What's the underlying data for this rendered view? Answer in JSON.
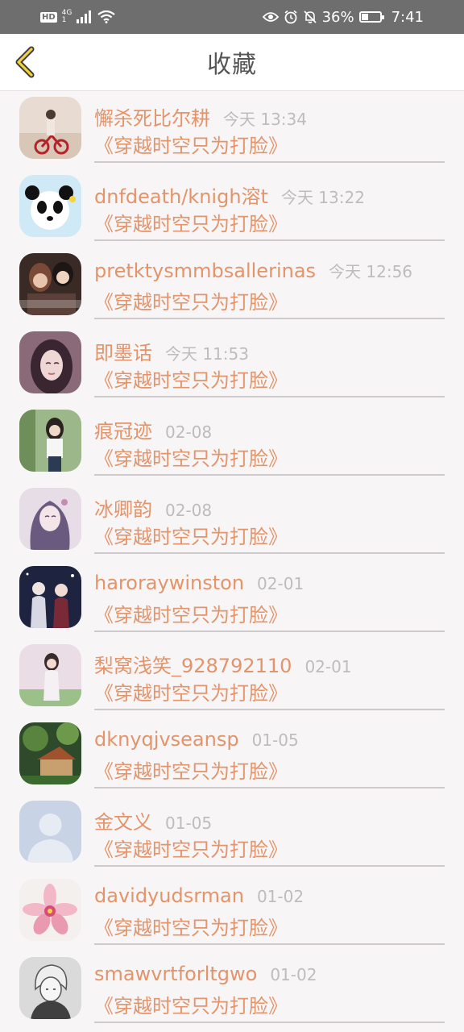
{
  "status_bar": {
    "hd": "HD",
    "network_top": "4G",
    "network_bottom": "1",
    "battery_pct": "36%",
    "battery_level": 0.36,
    "time": "7:41"
  },
  "header": {
    "title": "收藏",
    "back_icon": "chevron-left-icon"
  },
  "colors": {
    "accent": "#e3946a",
    "time": "#bdbdbd",
    "title": "#555555"
  },
  "favorites": [
    {
      "name": "懈杀死比尔耕",
      "time": "今天 13:34",
      "book": "《穿越时空只为打脸》"
    },
    {
      "name": "dnfdeath/knigh溶t",
      "time": "今天 13:22",
      "book": "《穿越时空只为打脸》"
    },
    {
      "name": "pretktysmmbsallerinas",
      "time": "今天 12:56",
      "book": "《穿越时空只为打脸》"
    },
    {
      "name": "即墨话",
      "time": "今天 11:53",
      "book": "《穿越时空只为打脸》"
    },
    {
      "name": "痕冠迹",
      "time": "02-08",
      "book": "《穿越时空只为打脸》"
    },
    {
      "name": "冰卿韵",
      "time": "02-08",
      "book": "《穿越时空只为打脸》"
    },
    {
      "name": "haroraywinston",
      "time": "02-01",
      "book": "《穿越时空只为打脸》"
    },
    {
      "name": "梨窝浅笑_928792110",
      "time": "02-01",
      "book": "《穿越时空只为打脸》"
    },
    {
      "name": "dknyqjvseansp",
      "time": "01-05",
      "book": "《穿越时空只为打脸》"
    },
    {
      "name": "金文义",
      "time": "01-05",
      "book": "《穿越时空只为打脸》"
    },
    {
      "name": "davidyudsrman",
      "time": "01-02",
      "book": "《穿越时空只为打脸》"
    },
    {
      "name": "smawvrtforltgwo",
      "time": "01-02",
      "book": "《穿越时空只为打脸》"
    }
  ]
}
